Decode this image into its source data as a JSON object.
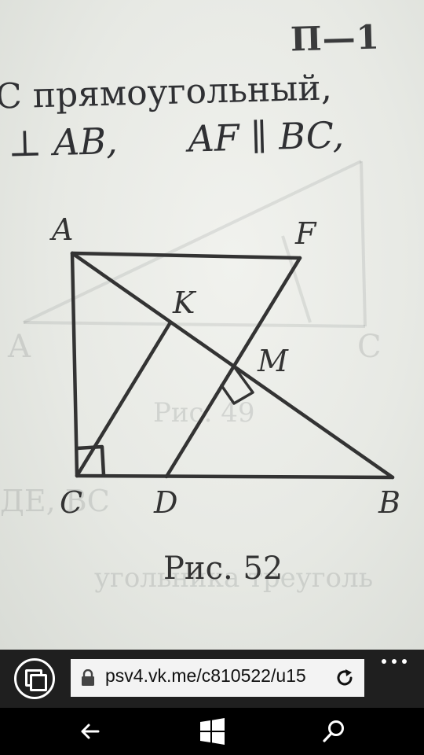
{
  "photo": {
    "page_code": "П—1",
    "text_line1": "C  прямоугольный,",
    "text_line2_part1": "⊥ AB,",
    "text_line2_part2": "AF ∥ BC,",
    "figure": {
      "points": {
        "A": "A",
        "F": "F",
        "K": "K",
        "M": "M",
        "C": "C",
        "D": "D",
        "B": "B"
      }
    },
    "caption": "Рис. 52"
  },
  "browser": {
    "url": "psv4.vk.me/c810522/u15",
    "icons": {
      "tabs": "tabs-icon",
      "lock": "lock-icon",
      "refresh": "refresh-icon",
      "more": "more-icon"
    }
  },
  "nav": {
    "icons": {
      "back": "back-arrow-icon",
      "start": "windows-start-icon",
      "search": "search-icon"
    }
  },
  "colors": {
    "paper": "#e9ebe6",
    "ink": "#2f3033",
    "bar": "#1f1f1f",
    "address_bg": "#f3f3f3"
  }
}
